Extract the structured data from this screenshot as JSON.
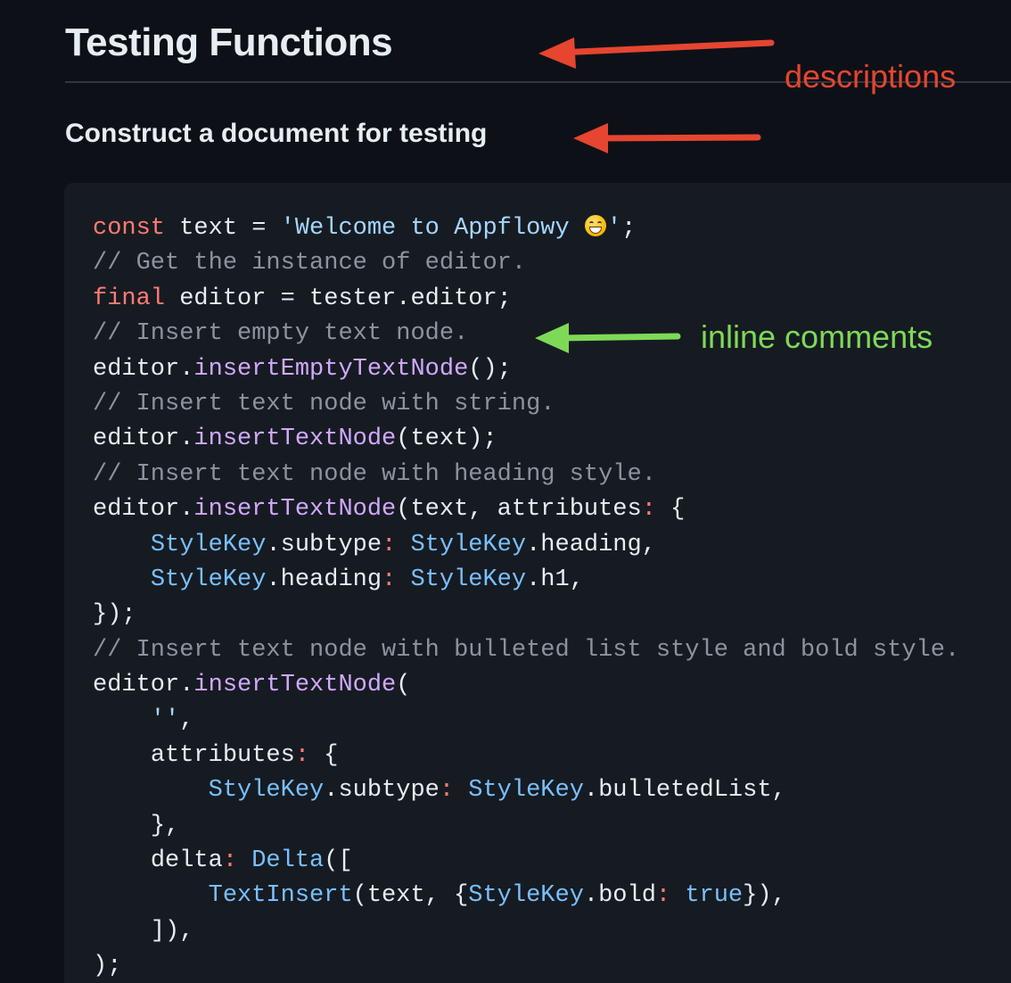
{
  "doc": {
    "title": "Testing Functions",
    "subtitle": "Construct a document for testing"
  },
  "annotations": {
    "descriptions": "descriptions",
    "inline_comments": "inline comments",
    "colors": {
      "descriptions": "#e64530",
      "inline_comments": "#7ed957"
    }
  },
  "code": {
    "l1": {
      "kw": "const",
      "a": " text = ",
      "str": "'Welcome to Appflowy ",
      "emoji": "grinning-face-icon",
      "str_end": "'",
      "b": ";"
    },
    "l2": "// Get the instance of editor.",
    "l3": {
      "kw": "final",
      "a": " editor = tester.editor;"
    },
    "l4": "// Insert empty text node.",
    "l5": {
      "a": "editor.",
      "fn": "insertEmptyTextNode",
      "b": "();"
    },
    "l6": "// Insert text node with string.",
    "l7": {
      "a": "editor.",
      "fn": "insertTextNode",
      "b": "(text);"
    },
    "l8": "// Insert text node with heading style.",
    "l9": {
      "a": "editor.",
      "fn": "insertTextNode",
      "b": "(text, attributes",
      "kw": ":",
      "c": " {"
    },
    "l10": {
      "indent": "    ",
      "ty1": "StyleKey",
      "a": ".subtype",
      "kw": ":",
      "sp": " ",
      "ty2": "StyleKey",
      "b": ".heading,"
    },
    "l11": {
      "indent": "    ",
      "ty1": "StyleKey",
      "a": ".heading",
      "kw": ":",
      "sp": " ",
      "ty2": "StyleKey",
      "b": ".h1,"
    },
    "l12": "});",
    "l13": "// Insert text node with bulleted list style and bold style.",
    "l14": {
      "a": "editor.",
      "fn": "insertTextNode",
      "b": "("
    },
    "l15": {
      "indent": "    ",
      "str": "''",
      "b": ","
    },
    "l16": {
      "indent": "    ",
      "a": "attributes",
      "kw": ":",
      "b": " {"
    },
    "l17": {
      "indent": "        ",
      "ty1": "StyleKey",
      "a": ".subtype",
      "kw": ":",
      "sp": " ",
      "ty2": "StyleKey",
      "b": ".bulletedList,"
    },
    "l18": {
      "indent": "    ",
      "a": "},"
    },
    "l19": {
      "indent": "    ",
      "a": "delta",
      "kw": ":",
      "sp": " ",
      "ty": "Delta",
      "b": "(["
    },
    "l20": {
      "indent": "        ",
      "ty1": "TextInsert",
      "a": "(text, {",
      "ty2": "StyleKey",
      "b": ".bold",
      "kw": ":",
      "sp": " ",
      "ty3": "true",
      "c": "}),"
    },
    "l21": {
      "indent": "    ",
      "a": "]),"
    },
    "l22": ");"
  }
}
